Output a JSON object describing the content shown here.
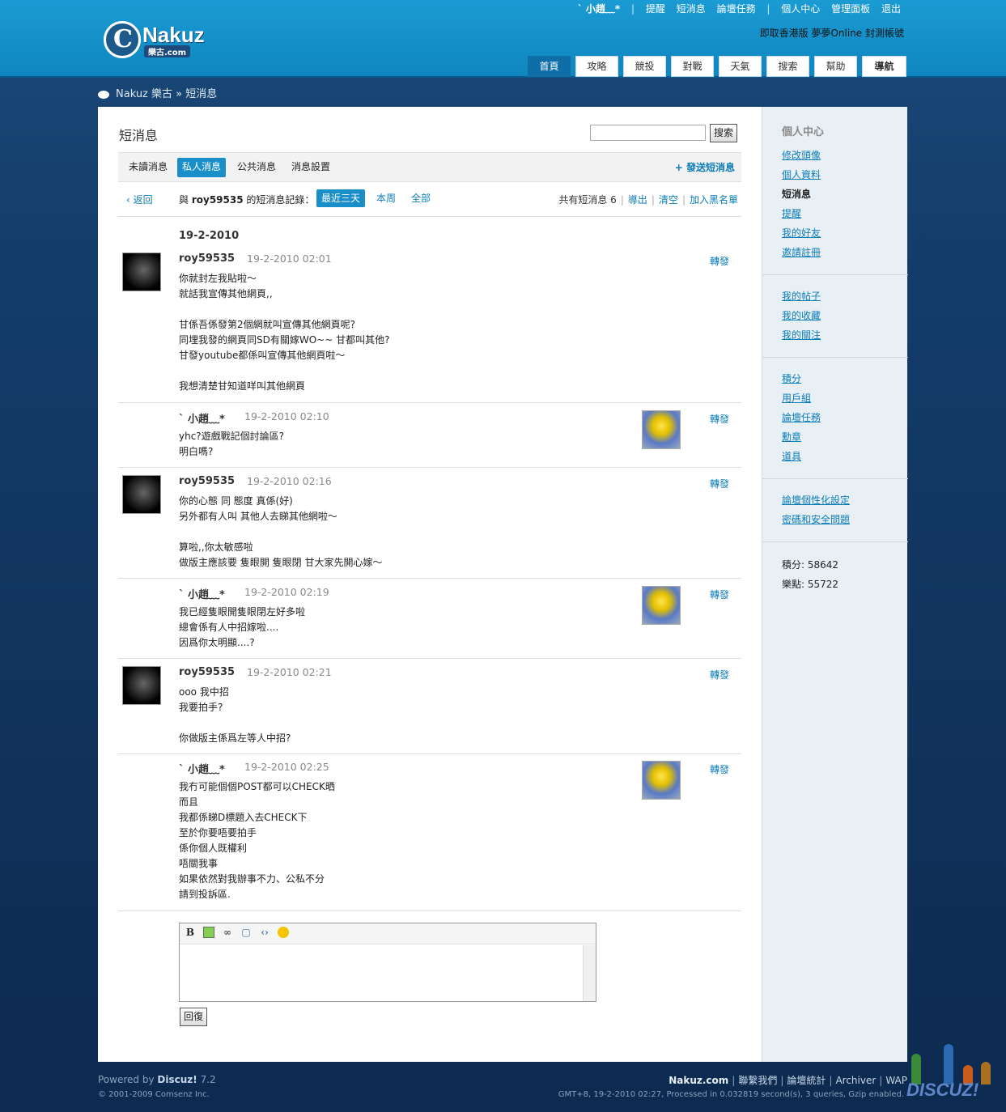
{
  "header": {
    "logo_text": "Nakuz",
    "logo_sub": "樂古.com",
    "user_name": "ˋ 小趙﹏*",
    "top_links": [
      "提醒",
      "短消息",
      "論壇任務",
      "個人中心",
      "管理面板",
      "退出"
    ],
    "announcement": "即取香港版 夢夢Online 封測帳號",
    "main_nav": [
      "首頁",
      "攻略",
      "競投",
      "對戰",
      "天氣",
      "搜索",
      "幫助",
      "導航"
    ]
  },
  "breadcrumb": {
    "site": "Nakuz 樂古",
    "sep": "»",
    "current": "短消息"
  },
  "page": {
    "title": "短消息",
    "search_button": "搜索",
    "tabs": [
      "未讀消息",
      "私人消息",
      "公共消息",
      "消息設置"
    ],
    "send_message": "+ 發送短消息",
    "back": "返回",
    "with_prefix": "與",
    "with_user": "roy59535",
    "with_suffix": "的短消息記錄：",
    "filters": [
      "最近三天",
      "本周",
      "全部"
    ],
    "total_label": "共有短消息 6",
    "actions": [
      "導出",
      "清空",
      "加入黑名單"
    ],
    "date_header": "19-2-2010",
    "forward_label": "轉發"
  },
  "messages": [
    {
      "author": "roy59535",
      "time": "19-2-2010 02:01",
      "body": "你就封左我貼啦～\n就話我宣傳其他網頁,,\n\n甘係吾係發第2個網就叫宣傳其他網頁呢?\n同埋我發的網頁同SD有關嫁WO~~ 甘都叫其他?\n甘發youtube都係叫宣傳其他網頁啦～\n\n我想清楚甘知道咩叫其他網頁"
    },
    {
      "author": "ˋ 小趙﹏*",
      "time": "19-2-2010 02:10",
      "body": "yhc?遊戲戰記個討論區?\n明白嗎?"
    },
    {
      "author": "roy59535",
      "time": "19-2-2010 02:16",
      "body": "你的心態 同 態度 真係(好)\n另外都有人叫 其他人去睇其他網啦～\n\n算啦,,你太敏感啦\n做版主應該要 隻眼開 隻眼閉 甘大家先開心嫁～"
    },
    {
      "author": "ˋ 小趙﹏*",
      "time": "19-2-2010 02:19",
      "body": "我已經隻眼開隻眼閉左好多啦\n總會係有人中招嫁啦....\n因爲你太明顯....?"
    },
    {
      "author": "roy59535",
      "time": "19-2-2010 02:21",
      "body": "ooo 我中招\n我要拍手?\n\n你做版主係爲左等人中招?"
    },
    {
      "author": "ˋ 小趙﹏*",
      "time": "19-2-2010 02:25",
      "body": "我冇可能個個POST都可以CHECK晒\n而且\n我都係睇D標題入去CHECK下\n至於你要唔要拍手\n係你個人既權利\n唔關我事\n如果依然對我辦事不力、公私不分\n請到投訴區."
    }
  ],
  "editor": {
    "tool_icons": [
      "bold-icon",
      "image-icon",
      "link-icon",
      "quote-icon",
      "code-icon",
      "smiley-icon"
    ],
    "reply_button": "回復"
  },
  "sidebar": {
    "title": "個人中心",
    "group1": [
      "修改頭像",
      "個人資料",
      "短消息",
      "提醒",
      "我的好友",
      "邀請註冊"
    ],
    "group2": [
      "我的帖子",
      "我的收藏",
      "我的關注"
    ],
    "group3": [
      "積分",
      "用戶組",
      "論壇任務",
      "勳章",
      "道具"
    ],
    "group4": [
      "論壇個性化設定",
      "密碼和安全問題"
    ],
    "credits": [
      "積分: 58642",
      "樂點: 55722"
    ]
  },
  "footer": {
    "powered_prefix": "Powered by",
    "powered_brand": "Discuz!",
    "powered_version": "7.2",
    "copyright": "© 2001-2009 Comsenz Inc.",
    "brand": "Nakuz.com",
    "links": [
      "聯繫我們",
      "論壇統計",
      "Archiver",
      "WAP"
    ],
    "info": "GMT+8, 19-2-2010 02:27, Processed in 0.032819 second(s), 3 queries, Gzip enabled.",
    "badge_text": "DISCUZ!"
  },
  "colors": {
    "accent": "#1a8ec8",
    "link": "#0b7db8",
    "header": "#1b9bd3",
    "background": "#143d6a"
  }
}
